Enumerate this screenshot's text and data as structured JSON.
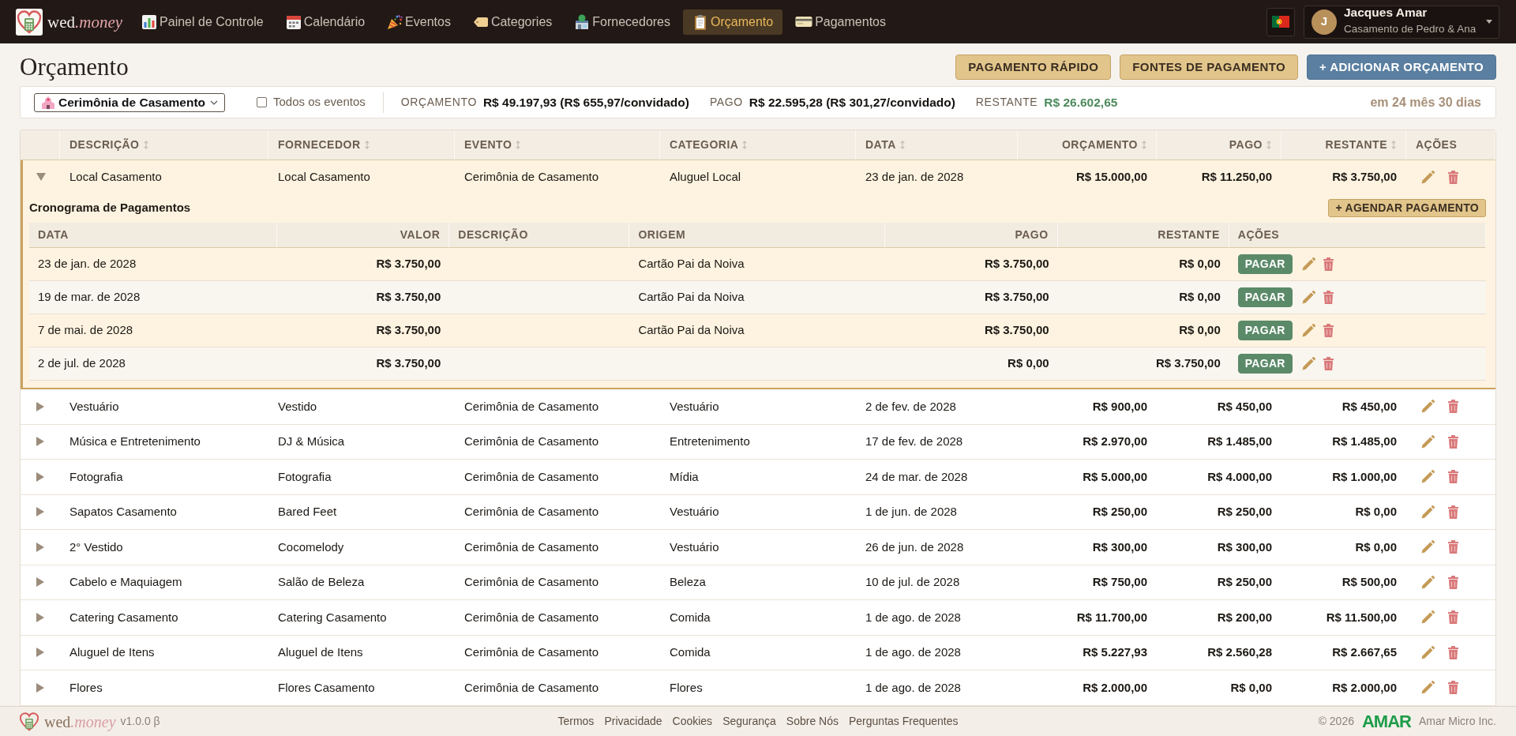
{
  "brand": {
    "name": "wed",
    "suffix": ".money"
  },
  "nav": {
    "items": [
      {
        "label": "Painel de Controle",
        "selected": false
      },
      {
        "label": "Calendário",
        "selected": false
      },
      {
        "label": "Eventos",
        "selected": false
      },
      {
        "label": "Categories",
        "selected": false
      },
      {
        "label": "Fornecedores",
        "selected": false
      },
      {
        "label": "Orçamento",
        "selected": true
      },
      {
        "label": "Pagamentos",
        "selected": false
      }
    ]
  },
  "user": {
    "initial": "J",
    "name": "Jacques Amar",
    "subtitle": "Casamento de Pedro & Ana"
  },
  "page": {
    "title": "Orçamento",
    "actions": [
      {
        "label": "PAGAMENTO RÁPIDO",
        "kind": "secondary"
      },
      {
        "label": "FONTES DE PAGAMENTO",
        "kind": "secondary"
      },
      {
        "label": "+ ADICIONAR ORÇAMENTO",
        "kind": "primary"
      }
    ]
  },
  "filter": {
    "event": "Cerimônia de Casamento",
    "all_events": {
      "label": "Todos os eventos",
      "checked": false
    },
    "summary": [
      {
        "label": "ORÇAMENTO",
        "value": "R$ 49.197,93 (R$ 655,97/convidado)",
        "kind": "neutral"
      },
      {
        "label": "PAGO",
        "value": "R$ 22.595,28 (R$ 301,27/convidado)",
        "kind": "neutral"
      },
      {
        "label": "RESTANTE",
        "value": "R$ 26.602,65",
        "kind": "positive"
      }
    ],
    "countdown": "em 24 mês 30 dias"
  },
  "table": {
    "columns": [
      {
        "label": "DESCRIÇÃO",
        "kind": "text",
        "sortable": true
      },
      {
        "label": "FORNECEDOR",
        "kind": "text",
        "sortable": true
      },
      {
        "label": "EVENTO",
        "kind": "text",
        "sortable": true
      },
      {
        "label": "CATEGORIA",
        "kind": "text",
        "sortable": true
      },
      {
        "label": "DATA",
        "kind": "text",
        "sortable": true
      },
      {
        "label": "ORÇAMENTO",
        "kind": "money",
        "sortable": true
      },
      {
        "label": "PAGO",
        "kind": "money",
        "sortable": true
      },
      {
        "label": "RESTANTE",
        "kind": "money",
        "sortable": true
      },
      {
        "label": "AÇÕES",
        "kind": "actions",
        "sortable": false
      }
    ],
    "rows": [
      {
        "expanded": true,
        "cells": [
          "Local Casamento",
          "Local Casamento",
          "Cerimônia de Casamento",
          "Aluguel Local",
          "23 de jan. de 2028",
          "R$ 15.000,00",
          "R$ 11.250,00",
          "R$ 3.750,00"
        ],
        "schedule": {
          "title": "Cronograma de Pagamentos",
          "button": "+ AGENDAR PAGAMENTO",
          "columns": [
            {
              "label": "DATA",
              "kind": "text"
            },
            {
              "label": "VALOR",
              "kind": "money"
            },
            {
              "label": "DESCRIÇÃO",
              "kind": "text"
            },
            {
              "label": "ORIGEM",
              "kind": "text"
            },
            {
              "label": "PAGO",
              "kind": "money"
            },
            {
              "label": "RESTANTE",
              "kind": "money"
            },
            {
              "label": "AÇÕES",
              "kind": "actions"
            }
          ],
          "payments": [
            {
              "date": "23 de jan. de 2028",
              "amount": "R$ 3.750,00",
              "origin": "Cartão Pai da Noiva",
              "paid": "R$ 3.750,00",
              "remaining": "R$ 0,00",
              "action": "PAGAR"
            },
            {
              "date": "19 de mar. de 2028",
              "amount": "R$ 3.750,00",
              "origin": "Cartão Pai da Noiva",
              "paid": "R$ 3.750,00",
              "remaining": "R$ 0,00",
              "action": "PAGAR"
            },
            {
              "date": "7 de mai. de 2028",
              "amount": "R$ 3.750,00",
              "origin": "Cartão Pai da Noiva",
              "paid": "R$ 3.750,00",
              "remaining": "R$ 0,00",
              "action": "PAGAR"
            },
            {
              "date": "2 de jul. de 2028",
              "amount": "R$ 3.750,00",
              "paid": "R$ 0,00",
              "remaining": "R$ 3.750,00",
              "action": "PAGAR"
            }
          ]
        }
      },
      {
        "expanded": false,
        "cells": [
          "Vestuário",
          "Vestido",
          "Cerimônia de Casamento",
          "Vestuário",
          "2 de fev. de 2028",
          "R$ 900,00",
          "R$ 450,00",
          "R$ 450,00"
        ]
      },
      {
        "expanded": false,
        "cells": [
          "Música e Entretenimento",
          "DJ & Música",
          "Cerimônia de Casamento",
          "Entretenimento",
          "17 de fev. de 2028",
          "R$ 2.970,00",
          "R$ 1.485,00",
          "R$ 1.485,00"
        ]
      },
      {
        "expanded": false,
        "cells": [
          "Fotografia",
          "Fotografia",
          "Cerimônia de Casamento",
          "Mídia",
          "24 de mar. de 2028",
          "R$ 5.000,00",
          "R$ 4.000,00",
          "R$ 1.000,00"
        ]
      },
      {
        "expanded": false,
        "cells": [
          "Sapatos Casamento",
          "Bared Feet",
          "Cerimônia de Casamento",
          "Vestuário",
          "1 de jun. de 2028",
          "R$ 250,00",
          "R$ 250,00",
          "R$ 0,00"
        ]
      },
      {
        "expanded": false,
        "cells": [
          "2° Vestido",
          "Cocomelody",
          "Cerimônia de Casamento",
          "Vestuário",
          "26 de jun. de 2028",
          "R$ 300,00",
          "R$ 300,00",
          "R$ 0,00"
        ]
      },
      {
        "expanded": false,
        "cells": [
          "Cabelo e Maquiagem",
          "Salão de Beleza",
          "Cerimônia de Casamento",
          "Beleza",
          "10 de jul. de 2028",
          "R$ 750,00",
          "R$ 250,00",
          "R$ 500,00"
        ]
      },
      {
        "expanded": false,
        "cells": [
          "Catering Casamento",
          "Catering Casamento",
          "Cerimônia de Casamento",
          "Comida",
          "1 de ago. de 2028",
          "R$ 11.700,00",
          "R$ 200,00",
          "R$ 11.500,00"
        ]
      },
      {
        "expanded": false,
        "cells": [
          "Aluguel de Itens",
          "Aluguel de Itens",
          "Cerimônia de Casamento",
          "Comida",
          "1 de ago. de 2028",
          "R$ 5.227,93",
          "R$ 2.560,28",
          "R$ 2.667,65"
        ]
      },
      {
        "expanded": false,
        "cells": [
          "Flores",
          "Flores Casamento",
          "Cerimônia de Casamento",
          "Flores",
          "1 de ago. de 2028",
          "R$ 2.000,00",
          "R$ 0,00",
          "R$ 2.000,00"
        ]
      }
    ]
  },
  "footer": {
    "brand": {
      "name": "wed",
      "suffix": ".money"
    },
    "version": "v1.0.0 β",
    "links": [
      "Termos",
      "Privacidade",
      "Cookies",
      "Segurança",
      "Sobre Nós",
      "Perguntas Frequentes"
    ],
    "copyright": "© 2026",
    "company_logo": "AMAR",
    "company": "Amar Micro Inc."
  }
}
